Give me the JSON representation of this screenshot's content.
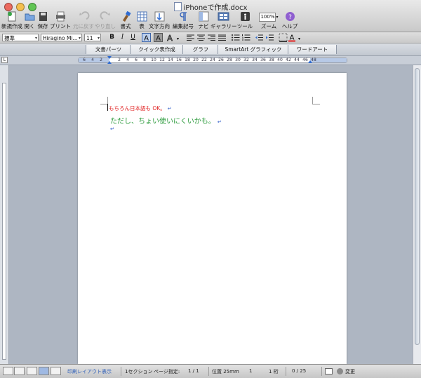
{
  "window": {
    "title": "iPhoneで作成.docx"
  },
  "toolbar": [
    {
      "name": "new",
      "label": "新規作成",
      "icon": "new-document-icon",
      "enabled": true
    },
    {
      "name": "open",
      "label": "開く",
      "icon": "folder-open-icon",
      "enabled": true
    },
    {
      "name": "save",
      "label": "保存",
      "icon": "save-icon",
      "enabled": true
    },
    {
      "name": "print",
      "label": "プリント",
      "icon": "printer-icon",
      "enabled": true
    },
    {
      "name": "undo",
      "label": "元に戻す",
      "icon": "undo-icon",
      "enabled": false
    },
    {
      "name": "redo",
      "label": "やり直し",
      "icon": "redo-icon",
      "enabled": false
    },
    {
      "name": "format",
      "label": "書式",
      "icon": "paintbrush-icon",
      "enabled": true
    },
    {
      "name": "table",
      "label": "表",
      "icon": "table-icon",
      "enabled": true
    },
    {
      "name": "textdir",
      "label": "文字方向",
      "icon": "text-direction-icon",
      "enabled": true
    },
    {
      "name": "editmark",
      "label": "編集記号",
      "icon": "pilcrow-icon",
      "enabled": true
    },
    {
      "name": "navi",
      "label": "ナビ",
      "icon": "sidebar-icon",
      "enabled": true
    },
    {
      "name": "gallery",
      "label": "ギャラリー",
      "icon": "gallery-icon",
      "enabled": true
    },
    {
      "name": "tools",
      "label": "ツール",
      "icon": "toolbox-icon",
      "enabled": true
    },
    {
      "name": "zoom",
      "label": "ズーム",
      "icon": "zoom-icon",
      "enabled": true
    },
    {
      "name": "help",
      "label": "ヘルプ",
      "icon": "help-icon",
      "enabled": true
    }
  ],
  "zoom": {
    "value": "100%"
  },
  "format": {
    "style": "標準",
    "font": "Hiragino Mi...",
    "size": "11",
    "bold": "B",
    "italic": "I",
    "underline": "U",
    "font_color": "#e02020"
  },
  "gallery_tabs": [
    "文書パーツ",
    "クイック表作成",
    "グラフ",
    "SmartArt グラフィック",
    "ワードアート"
  ],
  "ruler": {
    "ticks": [
      "6",
      "4",
      "2",
      "2",
      "4",
      "6",
      "8",
      "10",
      "12",
      "14",
      "16",
      "18",
      "20",
      "22",
      "24",
      "26",
      "28",
      "30",
      "32",
      "34",
      "36",
      "38",
      "40",
      "42",
      "44",
      "46",
      "48"
    ]
  },
  "document": {
    "line1": "もちろん日本語も OK。",
    "line2": "ただし、ちょい使いにくいかも。",
    "pilcrow": "↵",
    "line1_color": "#e02020",
    "line2_color": "#2a9a3a"
  },
  "status": {
    "view": "印刷レイアウト表示",
    "section": "1セクション",
    "page_label": "ページ指定:",
    "page_value": "1 / 1",
    "position": "位置 25mm",
    "line": "1",
    "column": "1 桁",
    "words": "0 / 25",
    "track": "変更"
  }
}
